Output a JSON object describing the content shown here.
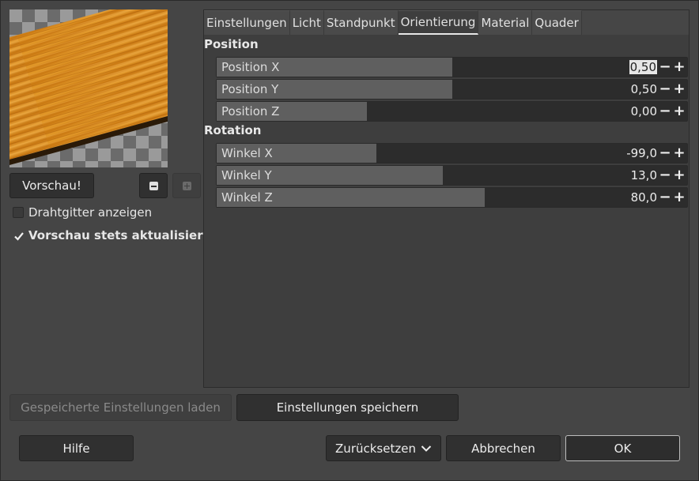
{
  "preview": {
    "button_label": "Vorschau!",
    "zoom_out_icon": "minus-icon",
    "zoom_in_icon": "plus-icon"
  },
  "options": {
    "wireframe_label": "Drahtgitter anzeigen",
    "wireframe_checked": false,
    "auto_update_label": "Vorschau stets aktualisieren",
    "auto_update_checked": true
  },
  "tabs": [
    {
      "label": "Einstellungen",
      "active": false
    },
    {
      "label": "Licht",
      "active": false
    },
    {
      "label": "Standpunkt",
      "active": false
    },
    {
      "label": "Orientierung",
      "active": true
    },
    {
      "label": "Material",
      "active": false
    },
    {
      "label": "Quader",
      "active": false
    }
  ],
  "position": {
    "title": "Position",
    "sliders": [
      {
        "label": "Position X",
        "value": "0,50",
        "fraction": 0.5
      },
      {
        "label": "Position Y",
        "value": "0,50",
        "fraction": 0.5
      },
      {
        "label": "Position Z",
        "value": "0,00",
        "fraction": 0.32
      }
    ]
  },
  "rotation": {
    "title": "Rotation",
    "sliders": [
      {
        "label": "Winkel X",
        "value": "-99,0",
        "fraction": 0.34
      },
      {
        "label": "Winkel Y",
        "value": "13,0",
        "fraction": 0.48
      },
      {
        "label": "Winkel Z",
        "value": "80,0",
        "fraction": 0.57
      }
    ]
  },
  "bottom": {
    "load_label": "Gespeicherte Einstellungen laden",
    "save_label": "Einstellungen speichern",
    "help_label": "Hilfe",
    "reset_label": "Zurücksetzen",
    "cancel_label": "Abbrechen",
    "ok_label": "OK"
  },
  "colors": {
    "background": "#454545",
    "slider_fill": "#5f5f5f",
    "slider_track": "#2c2c2c",
    "wood": "#d88a1a"
  }
}
